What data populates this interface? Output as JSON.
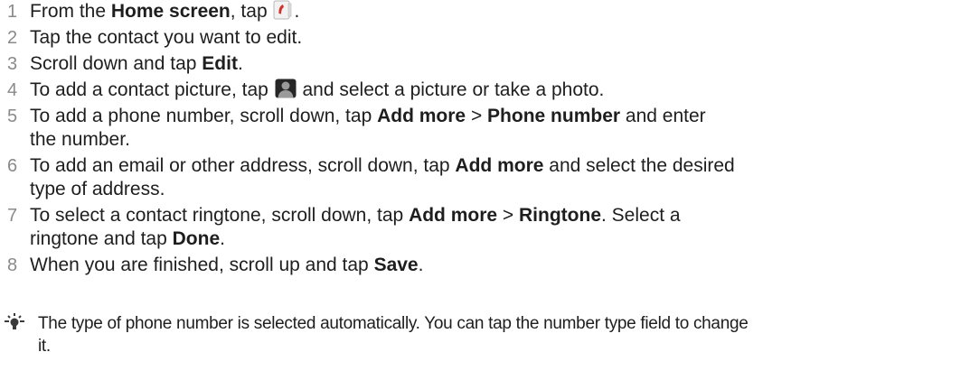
{
  "steps": [
    {
      "num": "1",
      "parts": [
        {
          "t": "From the "
        },
        {
          "t": "Home screen",
          "b": true
        },
        {
          "t": ", tap "
        },
        {
          "icon": "phone-app-icon"
        },
        {
          "t": "."
        }
      ]
    },
    {
      "num": "2",
      "parts": [
        {
          "t": "Tap the contact you want to edit."
        }
      ]
    },
    {
      "num": "3",
      "parts": [
        {
          "t": "Scroll down and tap "
        },
        {
          "t": "Edit",
          "b": true
        },
        {
          "t": "."
        }
      ]
    },
    {
      "num": "4",
      "parts": [
        {
          "t": "To add a contact picture, tap "
        },
        {
          "icon": "contact-picture-icon"
        },
        {
          "t": " and select a picture or take a photo."
        }
      ]
    },
    {
      "num": "5",
      "parts": [
        {
          "t": "To add a phone number, scroll down, tap "
        },
        {
          "t": "Add more",
          "b": true
        },
        {
          "t": " > "
        },
        {
          "t": "Phone number",
          "b": true
        },
        {
          "t": " and enter"
        },
        {
          "br": true
        },
        {
          "t": "the number."
        }
      ]
    },
    {
      "num": "6",
      "parts": [
        {
          "t": "To add an email or other address, scroll down, tap "
        },
        {
          "t": "Add more",
          "b": true
        },
        {
          "t": " and select the desired"
        },
        {
          "br": true
        },
        {
          "t": "type of address."
        }
      ]
    },
    {
      "num": "7",
      "parts": [
        {
          "t": "To select a contact ringtone, scroll down, tap "
        },
        {
          "t": "Add more",
          "b": true
        },
        {
          "t": " > "
        },
        {
          "t": "Ringtone",
          "b": true
        },
        {
          "t": ". Select a"
        },
        {
          "br": true
        },
        {
          "t": "ringtone and tap "
        },
        {
          "t": "Done",
          "b": true
        },
        {
          "t": "."
        }
      ]
    },
    {
      "num": "8",
      "parts": [
        {
          "t": "When you are finished, scroll up and tap "
        },
        {
          "t": "Save",
          "b": true
        },
        {
          "t": "."
        }
      ]
    }
  ],
  "tip": {
    "icon": "lightbulb-tip-icon",
    "line1": "The type of phone number is selected automatically. You can tap the number type field to change",
    "line2": "it."
  },
  "colors": {
    "text": "#1e1e1e",
    "step_number": "#8a8a8a",
    "phone_icon_red": "#d0342c",
    "tip_icon": "#3a3a3a"
  }
}
